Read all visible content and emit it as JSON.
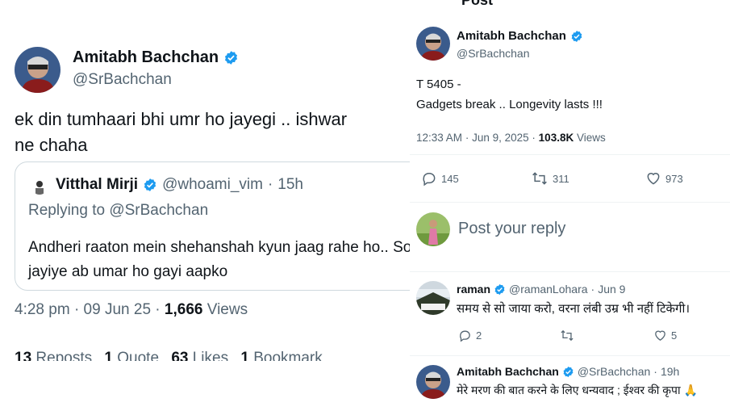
{
  "left_post": {
    "author_name": "Amitabh Bachchan",
    "author_handle": "@SrBachchan",
    "text": "ek din tumhaari bhi umr ho jayegi .. ishwar\nne chaha",
    "quote": {
      "author_name": "Vitthal Mirji",
      "author_handle": "@whoami_vim",
      "separator": "·",
      "age": "15h",
      "replying_to": "Replying to @SrBachchan",
      "text": "Andheri raaton mein shehanshah kyun jaag rahe ho.. So jayiye ab umar ho gayi aapko"
    },
    "time": "4:28 pm",
    "date": "09 Jun 25",
    "dot": "·",
    "views_count": "1,666",
    "views_label": "Views",
    "stats": [
      {
        "count": "13",
        "label": "Reposts"
      },
      {
        "count": "1",
        "label": "Quote"
      },
      {
        "count": "63",
        "label": "Likes"
      },
      {
        "count": "1",
        "label": "Bookmark"
      }
    ]
  },
  "right_post": {
    "header": "Post",
    "author_name": "Amitabh Bachchan",
    "author_handle": "@SrBachchan",
    "text_line1": "T 5405 -",
    "text_line2": "Gadgets break .. Longevity lasts  !!!",
    "time": "12:33 AM",
    "date": "Jun 9, 2025",
    "dot": "·",
    "views_count": "103.8K",
    "views_label": "Views",
    "actions": {
      "replies": "145",
      "reposts": "311",
      "likes": "973"
    },
    "reply_placeholder": "Post your reply",
    "comments": [
      {
        "author_name": "raman",
        "author_handle": "@ramanLohara",
        "separator": "·",
        "age": "Jun 9",
        "text": "समय से सो जाया करो, वरना लंबी उम्र भी नहीं टिकेगी।",
        "replies": "2",
        "reposts": "",
        "likes": "5"
      },
      {
        "author_name": "Amitabh Bachchan",
        "author_handle": "@SrBachchan",
        "separator": "·",
        "age": "19h",
        "text": "मेरे मरण की बात करने के लिए धन्यवाद ; ईश्वर की कृपा 🙏"
      }
    ]
  },
  "colors": {
    "verified_blue": "#1d9bf0",
    "text": "#0f1419",
    "muted": "#536471",
    "border": "#cfd9de"
  },
  "icons": [
    "verified-badge-icon",
    "reply-icon",
    "repost-icon",
    "like-icon"
  ]
}
